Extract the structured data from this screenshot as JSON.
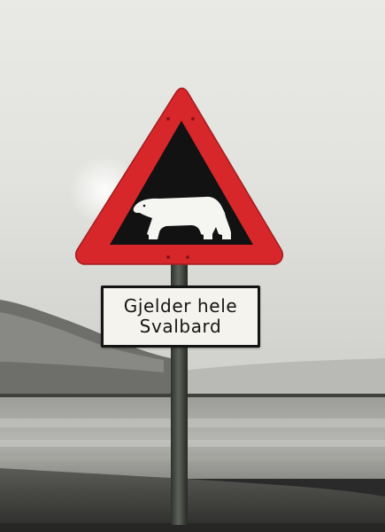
{
  "sign": {
    "type": "warning-triangle",
    "symbol": "polar-bear-icon",
    "border_color": "#d8272a",
    "field_color": "#121212",
    "symbol_color": "#f5f5f2"
  },
  "sub_sign": {
    "line1": "Gjelder hele",
    "line2": "Svalbard"
  }
}
